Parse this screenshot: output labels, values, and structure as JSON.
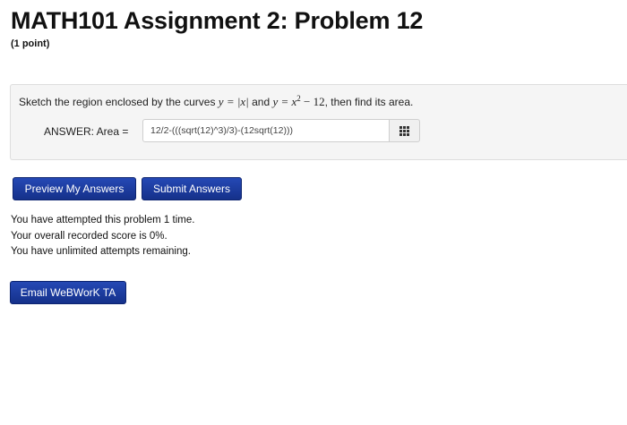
{
  "page": {
    "title": "MATH101 Assignment 2: Problem 12",
    "points": "(1 point)"
  },
  "problem": {
    "text_before": "Sketch the region enclosed by the curves ",
    "curve1": "y = |x|",
    "text_middle": " and ",
    "curve2_base": "y = x",
    "curve2_exp": "2",
    "curve2_rest": " − 12",
    "text_after": ", then find its area.",
    "answer_label": "ANSWER: Area = ",
    "answer_value": "12/2-(((sqrt(12)^3)/3)-(12sqrt(12)))"
  },
  "buttons": {
    "preview": "Preview My Answers",
    "submit": "Submit Answers",
    "email": "Email WeBWorK TA"
  },
  "status": {
    "attempts": "You have attempted this problem 1 time.",
    "score": "Your overall recorded score is 0%.",
    "remaining": "You have unlimited attempts remaining."
  },
  "colors": {
    "button_bg": "#1a3a9a",
    "panel_bg": "#f5f5f5"
  },
  "icons": {
    "palette": "grid-icon"
  }
}
